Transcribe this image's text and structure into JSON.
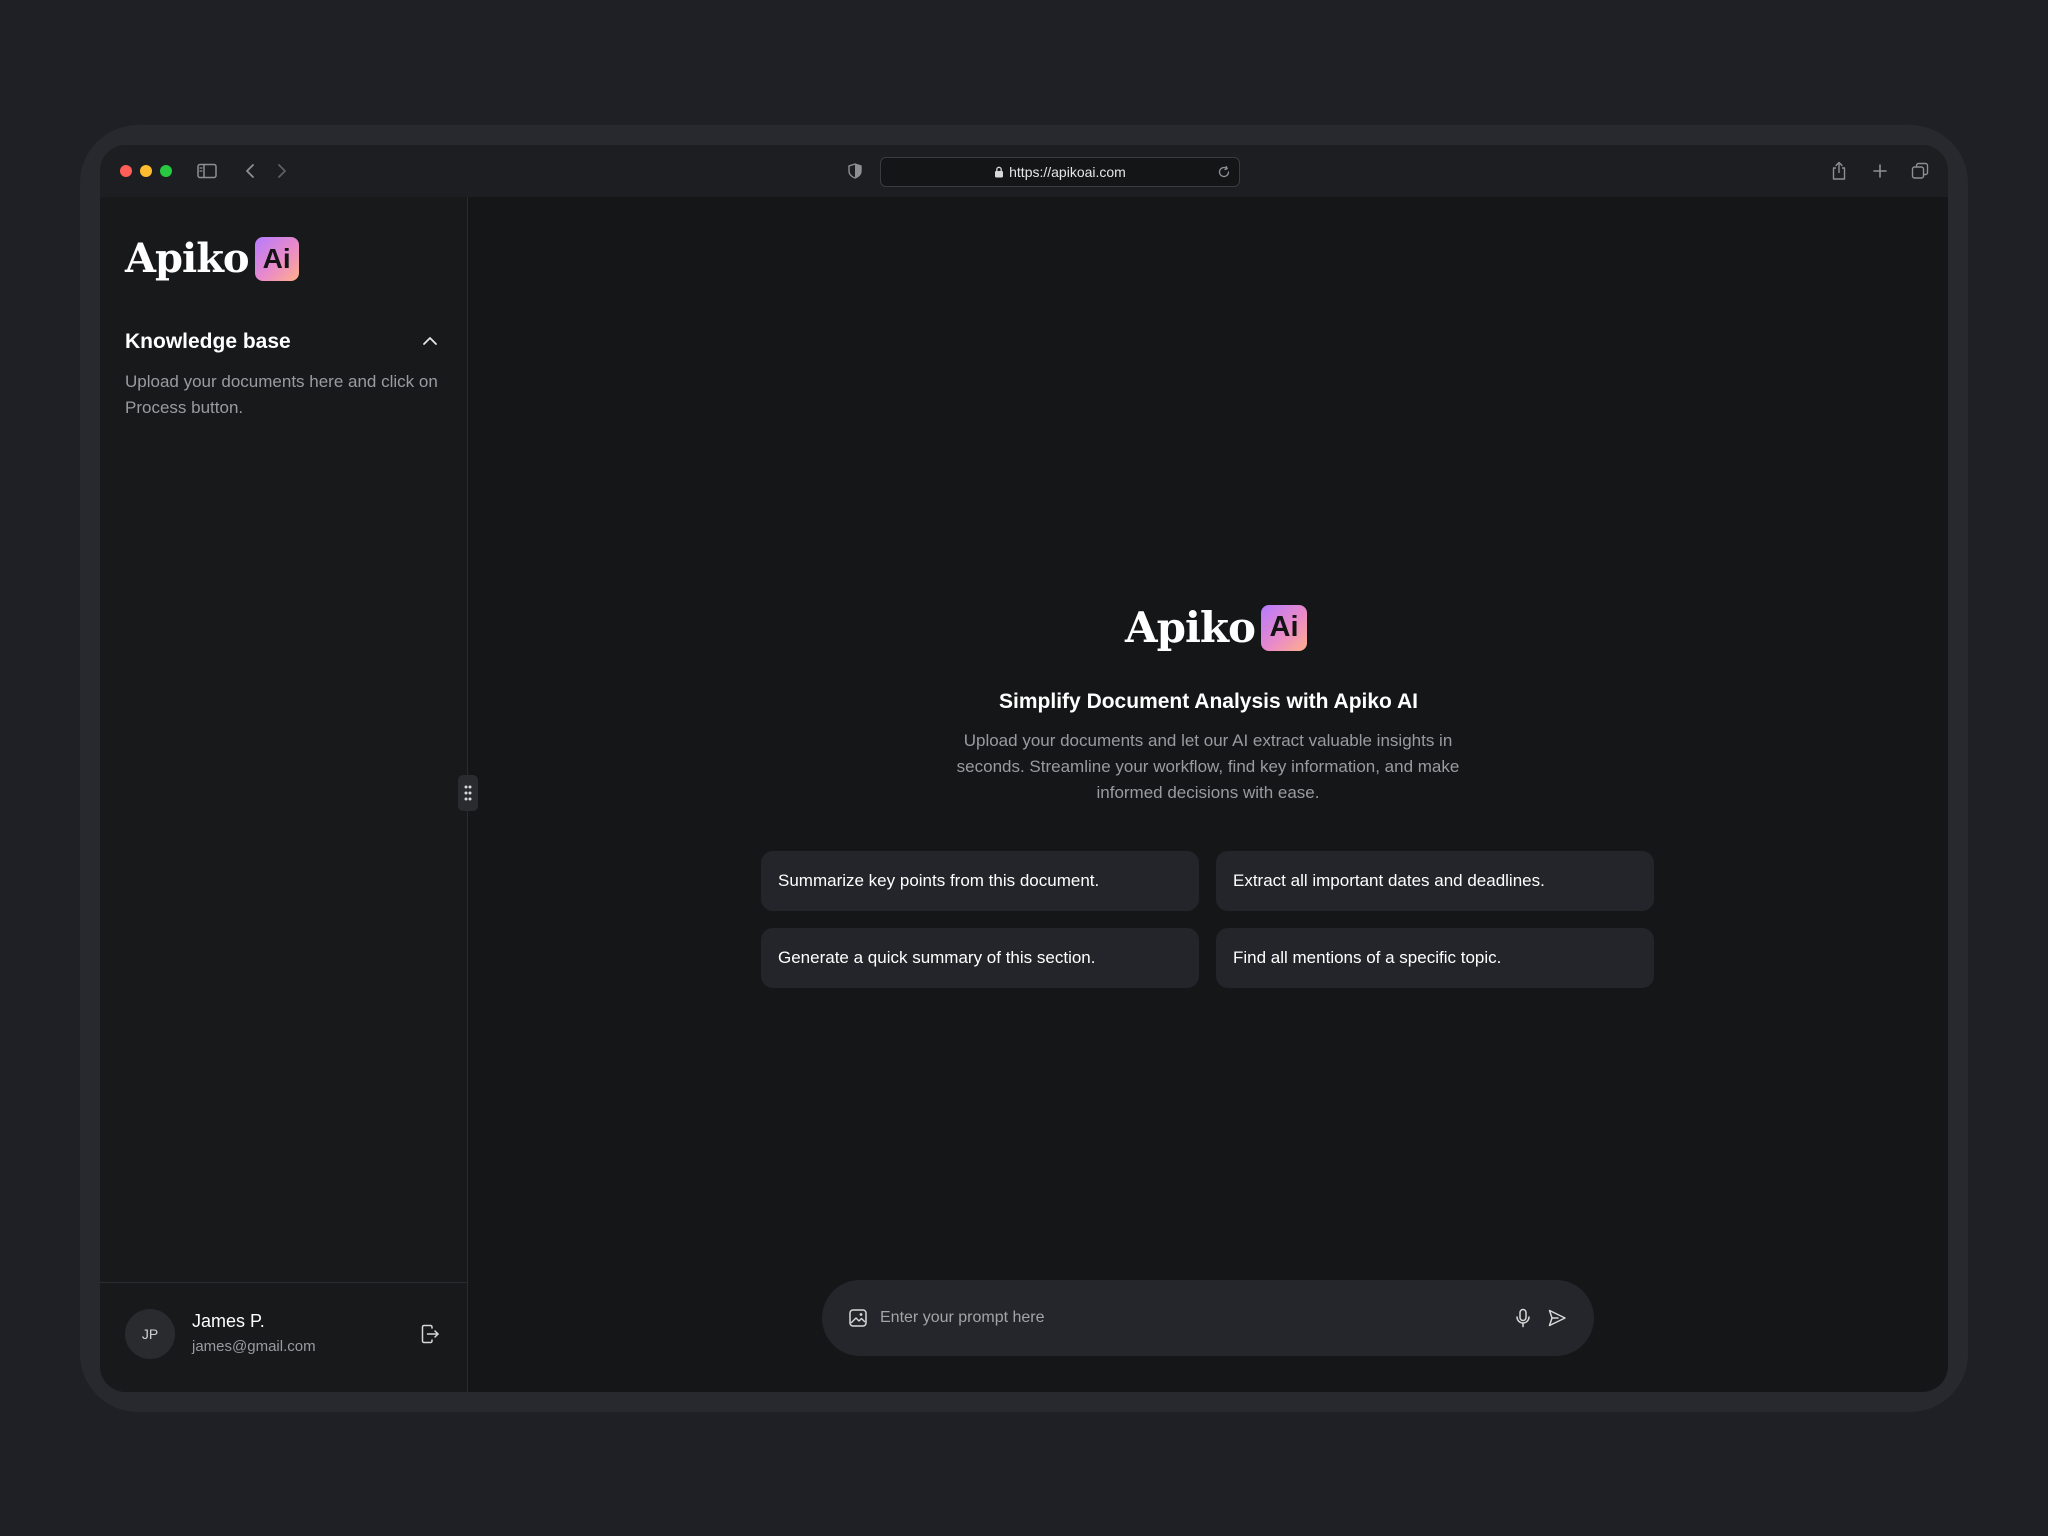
{
  "browser": {
    "url": "https://apikoai.com",
    "icons": [
      "sidebar-toggle-icon",
      "back-icon",
      "forward-icon",
      "shield-icon",
      "lock-icon",
      "reload-icon",
      "share-icon",
      "plus-icon",
      "tabs-icon"
    ]
  },
  "brand": {
    "name": "Apiko",
    "badge": "Ai",
    "badge_gradient": [
      "#b57bff",
      "#e98ac9",
      "#ffb08a"
    ]
  },
  "sidebar": {
    "section_title": "Knowledge base",
    "section_description": "Upload your documents here and click on Process button.",
    "user": {
      "initials": "JP",
      "name": "James P.",
      "email": "james@gmail.com"
    }
  },
  "main": {
    "headline": "Simplify Document Analysis with Apiko AI",
    "subtext": "Upload your documents and let our AI extract valuable insights in seconds. Streamline your workflow, find key information, and make informed decisions with ease.",
    "suggestions": [
      "Summarize key points from this document.",
      "Extract all important dates and deadlines.",
      "Generate a quick summary of this section.",
      "Find all mentions of a specific topic."
    ],
    "prompt": {
      "placeholder": "Enter your prompt here"
    }
  },
  "colors": {
    "background": "#1f2025",
    "panel": "#151617",
    "sidebar": "#18191b",
    "card": "#24252a",
    "text_muted": "#9a9ba0"
  }
}
